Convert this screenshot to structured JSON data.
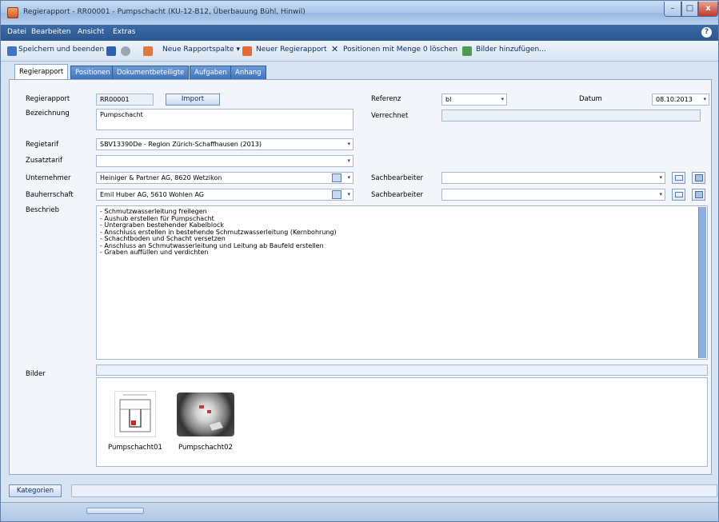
{
  "window": {
    "title": "Regierapport - RR00001 - Pumpschacht (KU-12-B12, Überbauung Bühl, Hinwil)",
    "controls": {
      "minimize": "–",
      "maximize": "□",
      "close": "x"
    }
  },
  "menu": [
    "Datei",
    "Bearbeiten",
    "Ansicht",
    "Extras"
  ],
  "help": "?",
  "toolbar": {
    "save_close": "Speichern und beenden",
    "new_column": "Neue Rapportspalte ▾",
    "new_report": "Neuer Regierapport",
    "delete_zero": "Positionen mit Menge 0 löschen",
    "add_images": "Bilder hinzufügen..."
  },
  "tabs": [
    "Regierapport",
    "Positionen",
    "Dokumentbeteiligte",
    "Aufgaben",
    "Anhang"
  ],
  "form": {
    "regierapport_label": "Regierapport",
    "regierapport_value": "RR00001",
    "import_label": "Import",
    "bezeichnung_label": "Bezeichnung",
    "bezeichnung_value": "Pumpschacht",
    "referenz_label": "Referenz",
    "referenz_value": "bl",
    "datum_label": "Datum",
    "datum_value": "08.10.2013",
    "verrechnet_label": "Verrechnet",
    "regietarif_label": "Regietarif",
    "regietarif_value": "SBV13390De - Region Zürich-Schaffhausen (2013)",
    "zusatztarif_label": "Zusatztarif",
    "unternehmer_label": "Unternehmer",
    "unternehmer_value": "Heiniger & Partner AG, 8620 Wetzikon",
    "sachbearbeiter_label": "Sachbearbeiter",
    "bauherrschaft_label": "Bauherrschaft",
    "bauherrschaft_value": "Emil Huber AG, 5610 Wohlen AG",
    "beschrieb_label": "Beschrieb",
    "beschrieb_lines": [
      "- Schmutzwasserleitung freilegen",
      "- Aushub erstellen für Pumpschacht",
      "- Untergraben bestehender Kabelblock",
      "- Anschluss erstellen in bestehende Schmutzwasserleitung (Kernbohrung)",
      "- Schachtboden und Schacht versetzen",
      "- Anschluss an Schmutwasserleitung und Leitung ab Baufeld erstellen",
      "- Graben auffüllen und verdichten"
    ],
    "bilder_label": "Bilder",
    "images": [
      "Pumpschacht01",
      "Pumpschacht02"
    ]
  },
  "footer": {
    "kategorien": "Kategorien"
  }
}
